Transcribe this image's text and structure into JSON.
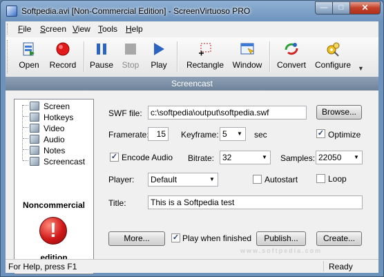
{
  "window": {
    "title": "Softpedia.avi [Non-Commercial Edition] - ScreenVirtuoso PRO"
  },
  "menu": [
    "File",
    "Screen",
    "View",
    "Tools",
    "Help"
  ],
  "toolbar": {
    "open": "Open",
    "record": "Record",
    "pause": "Pause",
    "stop": "Stop",
    "play": "Play",
    "rectangle": "Rectangle",
    "window": "Window",
    "convert": "Convert",
    "configure": "Configure"
  },
  "section_title": "Screencast",
  "tree": [
    "Screen",
    "Hotkeys",
    "Video",
    "Audio",
    "Notes",
    "Screencast"
  ],
  "noncommercial": {
    "line1": "Noncommercial",
    "line2": "edition",
    "icon": "!"
  },
  "form": {
    "swf_label": "SWF file:",
    "swf_value": "c:\\softpedia\\output\\softpedia.swf",
    "browse": "Browse...",
    "framerate_label": "Framerate:",
    "framerate_value": "15",
    "keyframe_label": "Keyframe:",
    "keyframe_value": "5",
    "sec": "sec",
    "optimize_label": "Optimize",
    "encode_audio_label": "Encode Audio",
    "bitrate_label": "Bitrate:",
    "bitrate_value": "32",
    "samples_label": "Samples:",
    "samples_value": "22050",
    "player_label": "Player:",
    "player_value": "Default",
    "autostart_label": "Autostart",
    "loop_label": "Loop",
    "title_label": "Title:",
    "title_value": "This is a Softpedia test",
    "more": "More...",
    "play_when_finished": "Play when finished",
    "publish": "Publish...",
    "create": "Create..."
  },
  "checks": {
    "optimize": true,
    "encode_audio": true,
    "autostart": false,
    "loop": false,
    "play_when_finished": true
  },
  "status": {
    "help": "For Help, press F1",
    "state": "Ready"
  },
  "watermark": "www.softpedia.com"
}
